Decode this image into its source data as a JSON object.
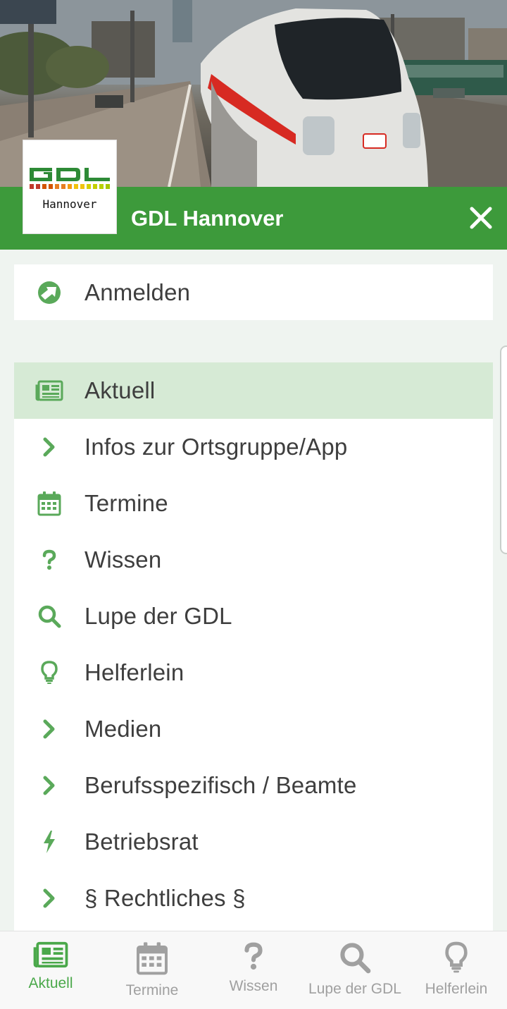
{
  "header": {
    "title": "GDL Hannover",
    "logo_subtitle": "Hannover",
    "logo_text": "GDL",
    "close_icon": "close-icon"
  },
  "login": {
    "label": "Anmelden",
    "icon": "login-icon"
  },
  "menu": {
    "items": [
      {
        "label": "Aktuell",
        "icon": "newspaper-icon",
        "active": true
      },
      {
        "label": "Infos zur Ortsgruppe/App",
        "icon": "chevron-right-icon"
      },
      {
        "label": "Termine",
        "icon": "calendar-icon"
      },
      {
        "label": "Wissen",
        "icon": "question-icon"
      },
      {
        "label": "Lupe der GDL",
        "icon": "search-icon"
      },
      {
        "label": "Helferlein",
        "icon": "lightbulb-icon"
      },
      {
        "label": "Medien",
        "icon": "chevron-right-icon"
      },
      {
        "label": "Berufsspezifisch / Beamte",
        "icon": "chevron-right-icon"
      },
      {
        "label": "Betriebsrat",
        "icon": "bolt-icon"
      },
      {
        "label": "§ Rechtliches §",
        "icon": "chevron-right-icon"
      }
    ]
  },
  "bottom_nav": {
    "tabs": [
      {
        "label": "Aktuell",
        "icon": "newspaper-icon",
        "active": true
      },
      {
        "label": "Termine",
        "icon": "calendar-icon"
      },
      {
        "label": "Wissen",
        "icon": "question-icon"
      },
      {
        "label": "Lupe der GDL",
        "icon": "search-icon"
      },
      {
        "label": "Helferlein",
        "icon": "lightbulb-icon"
      }
    ]
  },
  "colors": {
    "brand_green": "#3d9a3b",
    "icon_green": "#5aa95a",
    "active_bg": "#d6ead5",
    "active_tab": "#4aa84a",
    "inactive_tab": "#a0a0a0"
  }
}
